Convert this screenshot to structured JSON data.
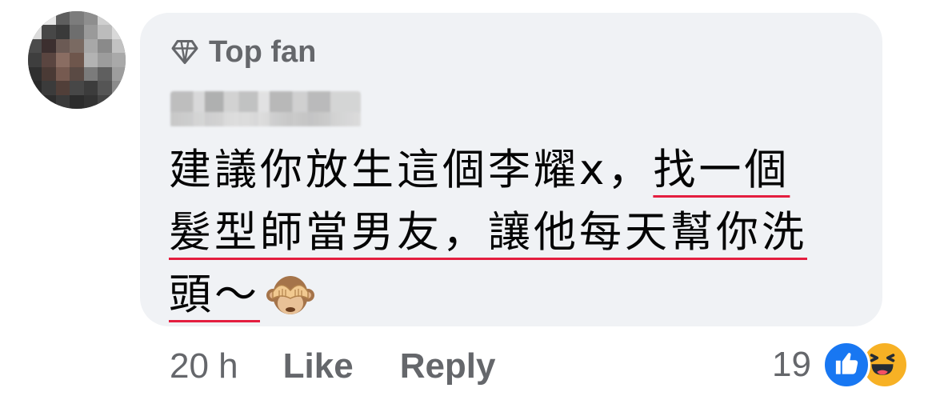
{
  "comment": {
    "badge_label": "Top fan",
    "badge_icon": "diamond-icon",
    "author_name_redacted": true,
    "text_lines": [
      {
        "plain": "建議你放生這個李耀x，",
        "underlined": "找一個"
      },
      {
        "plain": "",
        "underlined": "髮型師當男友，讓他每天幫你洗"
      },
      {
        "plain": "",
        "underlined": "頭～",
        "emoji": "see-no-evil-monkey"
      }
    ],
    "underline_color": "#e41e3f"
  },
  "meta": {
    "time": "20 h",
    "like_label": "Like",
    "reply_label": "Reply",
    "reaction_count": "19",
    "reactions": [
      "like-icon",
      "haha-icon"
    ]
  },
  "colors": {
    "bubble_bg": "#f0f2f5",
    "secondary_text": "#65676b",
    "like_blue": "#1877f2",
    "haha_yellow": "#f7b125"
  }
}
